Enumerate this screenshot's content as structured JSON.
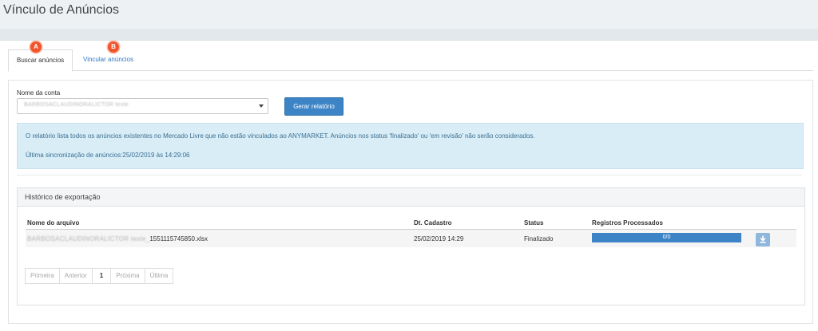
{
  "page": {
    "title": "Vínculo de Anúncios"
  },
  "tabs": [
    {
      "label": "Buscar anúncios",
      "badge": "A",
      "active": true
    },
    {
      "label": "Vincular anúncios",
      "badge": "B",
      "active": false
    }
  ],
  "form": {
    "account_label": "Nome da conta",
    "account_value": "BARBOSACLAUDINORALICTOR teste",
    "generate_button": "Gerar relatório"
  },
  "info": {
    "message": "O relatório lista todos os anúncios existentes no Mercado Livre que não estão vinculados ao ANYMARKET. Anúncios nos status 'finalizado' ou 'em revisão' não serão considerados.",
    "last_sync": "Última sincronização de anúncios:25/02/2019 às 14:29:06"
  },
  "history": {
    "title": "Histórico de exportação",
    "columns": [
      "Nome do arquivo",
      "Dt. Cadastro",
      "Status",
      "Registros Processados"
    ],
    "rows": [
      {
        "file_blurred": "BARBOSACLAUDINORALICTOR teste_",
        "file_suffix": "1551115745850.xlsx",
        "date": "25/02/2019 14:29",
        "status": "Finalizado",
        "processed": "0/0",
        "progress_fraction": 1.0
      }
    ]
  },
  "pagination": {
    "first": "Primeira",
    "prev": "Anterior",
    "current": "1",
    "next": "Próxima",
    "last": "Última"
  },
  "icons": {
    "download": "download-icon",
    "caret": "chevron-down-icon"
  },
  "colors": {
    "primary": "#3c84c6",
    "badge": "#f2552c",
    "info_bg": "#d9edf7",
    "link": "#3377c2"
  }
}
